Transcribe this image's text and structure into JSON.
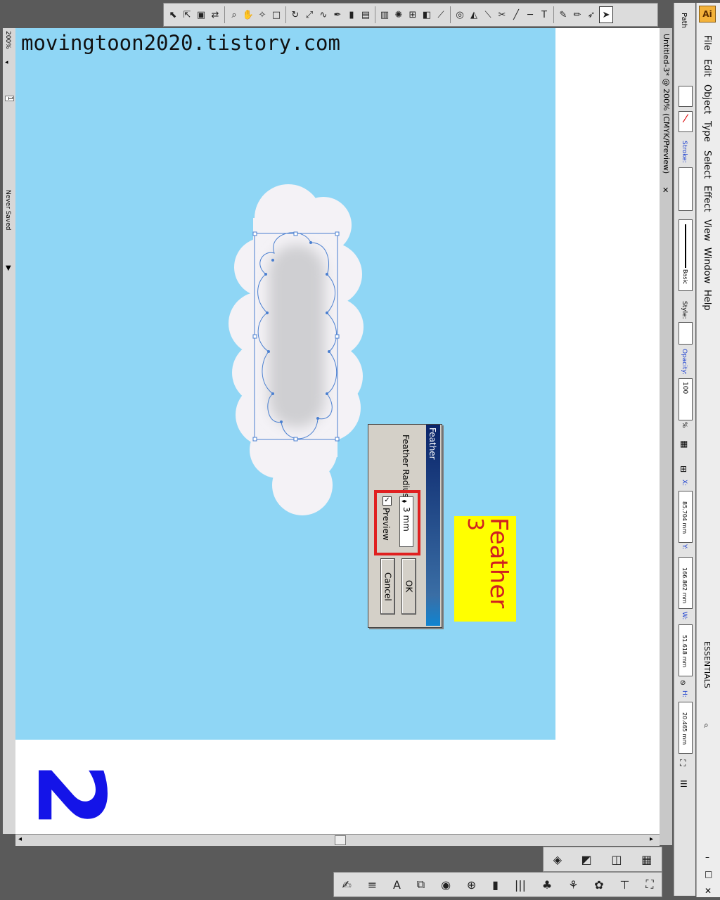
{
  "document": {
    "tab_title": "Untitled-3* @ 200% (CMYK/Preview)",
    "zoom": "200%",
    "page": "1",
    "save_status": "Never Saved"
  },
  "watermark": "movingtoon2020.tistory.com",
  "menu": [
    "File",
    "Edit",
    "Object",
    "Type",
    "Select",
    "Effect",
    "View",
    "Window",
    "Help"
  ],
  "app_logo": "Ai",
  "workspace": "ESSENTIALS",
  "control_panel": {
    "selection": "Path",
    "stroke_label": "Stroke:",
    "brush": "Basic",
    "style_label": "Style:",
    "opacity_label": "Opacity:",
    "opacity_value": "100",
    "opacity_unit": "%",
    "x_label": "X:",
    "x_value": "85.704 mm",
    "y_label": "Y:",
    "y_value": "166.862 mm",
    "w_label": "W:",
    "w_value": "51.618 mm",
    "h_label": "H:",
    "h_value": "20.465 mm"
  },
  "dialog": {
    "title": "Feather",
    "radius_label": "Feather Radius:",
    "radius_value": "3 mm",
    "preview_label": "Preview",
    "preview_checked": true,
    "ok_label": "OK",
    "cancel_label": "Cancel"
  },
  "annotation": {
    "note_line1": "Feather",
    "note_line2": "3",
    "step_number": "2",
    "note_color": "#ffff00",
    "highlight_color": "#e02020",
    "step_color": "#1414e8"
  },
  "colors": {
    "artboard_sky": "#8fd6f5",
    "cloud": "#f4f2f6",
    "selected_shape": "#cfcfd2",
    "selection_outline": "#4a7fd0"
  },
  "icons": {
    "toolbar_top": [
      "selection-icon",
      "direct-selection-icon",
      "stroke-fill-icon",
      "swap-icon",
      "zoom-icon",
      "hand-icon",
      "magic-wand-icon",
      "rectangle-icon",
      "rotate-icon",
      "scale-icon",
      "warp-icon",
      "pen-icon",
      "eraser-icon",
      "artboard-icon",
      "column-graph-icon",
      "symbol-sprayer-icon",
      "mesh-icon",
      "gradient-icon",
      "eyedropper-icon",
      "blend-icon",
      "live-paint-icon",
      "slice-icon",
      "scissors-icon",
      "knife-icon",
      "line-icon",
      "type-icon",
      "brush-icon",
      "pencil-icon",
      "lasso-icon",
      "arrow-icon"
    ],
    "bottom_row1": [
      "layers-icon",
      "gradient-panel-icon",
      "transparency-icon",
      "swatches-icon"
    ],
    "bottom_row2": [
      "brushes-icon",
      "stroke-icon",
      "character-icon",
      "transform-icon",
      "appearance-icon",
      "pathfinder-icon",
      "align-icon",
      "libraries-icon",
      "symbols-icon",
      "graphic-styles-icon",
      "color-guide-icon",
      "artboards-icon",
      "navigator-icon"
    ]
  }
}
